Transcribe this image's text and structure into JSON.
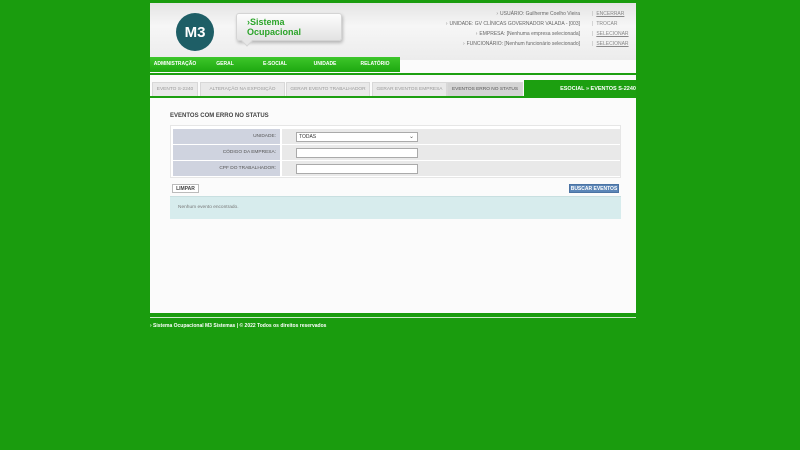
{
  "header": {
    "logo_text": "M3",
    "system_title": "›Sistema Ocupacional"
  },
  "user_info": [
    {
      "label": "USUÁRIO: Guilherme Coelho Vieira",
      "action": "ENCERRAR"
    },
    {
      "label": "UNIDADE: GV CLÍNICAS GOVERNADOR VALADA - [003]",
      "action": "TROCAR"
    },
    {
      "label": "EMPRESA: [Nenhuma empresa selecionada]",
      "action": "SELECIONAR"
    },
    {
      "label": "FUNCIONÁRIO: [Nenhum funcionário selecionado]",
      "action": "SELECIONAR"
    }
  ],
  "nav": [
    "ADMINISTRAÇÃO",
    "GERAL",
    "E-SOCIAL",
    "UNIDADE",
    "RELATÓRIO"
  ],
  "tabs": [
    {
      "label": "EVENTO S-2240",
      "active": false
    },
    {
      "label": "ALTERAÇÃO NA EXPOSIÇÃO",
      "active": false
    },
    {
      "label": "GERAR EVENTO TRABALHADOR",
      "active": false
    },
    {
      "label": "GERAR EVENTOS EMPRESA",
      "active": false
    },
    {
      "label": "EVENTOS ERRO NO STATUS",
      "active": true
    }
  ],
  "section_title": "ESOCIAL » EVENTOS S-2240",
  "form": {
    "title": "EVENTOS COM ERRO NO STATUS",
    "unidade_label": "UNIDADE:",
    "unidade_value": "TODAS",
    "codigo_label": "CÓDIGO DA EMPRESA:",
    "codigo_value": "",
    "cpf_label": "CPF DO TRABALHADOR:",
    "cpf_value": ""
  },
  "buttons": {
    "clear": "LIMPAR",
    "search": "BUSCAR EVENTOS"
  },
  "results_message": "Nenhum evento encontrado.",
  "footer": "› Sistema Ocupacional M3 Sistemas | © 2022 Todos os direitos reservados",
  "colors": {
    "background": "#1a9c0e",
    "nav_green": "#2bb51c",
    "logo_teal": "#1e5e66",
    "search_button": "#5c86b7",
    "results_bg": "#d7eced"
  }
}
